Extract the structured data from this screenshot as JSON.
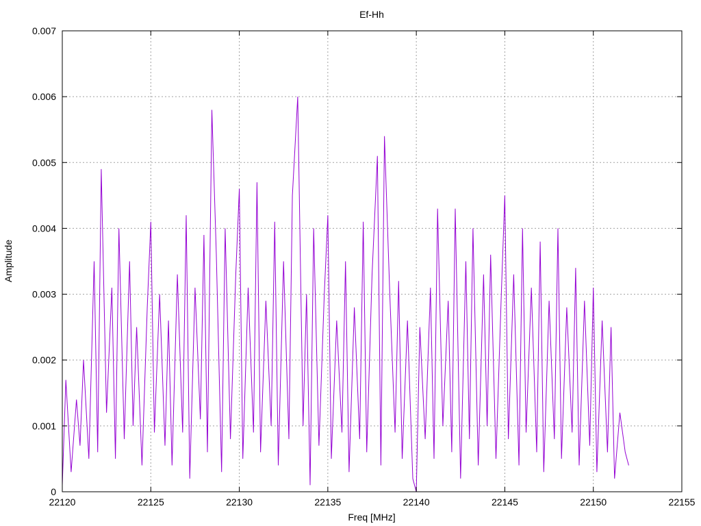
{
  "chart_data": {
    "type": "line",
    "title": "Ef-Hh",
    "xlabel": "Freq [MHz]",
    "ylabel": "Amplitude",
    "xlim": [
      22120,
      22155
    ],
    "ylim": [
      0,
      0.007
    ],
    "xticks": [
      22120,
      22125,
      22130,
      22135,
      22140,
      22145,
      22150,
      22155
    ],
    "yticks": [
      0,
      0.001,
      0.002,
      0.003,
      0.004,
      0.005,
      0.006,
      0.007
    ],
    "xtick_labels": [
      "22120",
      "22125",
      "22130",
      "22135",
      "22140",
      "22145",
      "22150",
      "22155"
    ],
    "ytick_labels": [
      "0",
      "0.001",
      "0.002",
      "0.003",
      "0.004",
      "0.005",
      "0.006",
      "0.007"
    ],
    "grid": true,
    "series_color": "#9400d3",
    "series": [
      {
        "x": [
          22120.0,
          22120.2,
          22120.5,
          22120.8,
          22121.0,
          22121.2,
          22121.5,
          22121.8,
          22122.0,
          22122.2,
          22122.5,
          22122.8,
          22123.0,
          22123.2,
          22123.5,
          22123.8,
          22124.0,
          22124.2,
          22124.5,
          22124.8,
          22125.0,
          22125.2,
          22125.5,
          22125.8,
          22126.0,
          22126.2,
          22126.5,
          22126.8,
          22127.0,
          22127.2,
          22127.5,
          22127.8,
          22128.0,
          22128.2,
          22128.45,
          22128.7,
          22129.0,
          22129.2,
          22129.5,
          22129.8,
          22130.0,
          22130.2,
          22130.5,
          22130.8,
          22131.0,
          22131.2,
          22131.5,
          22131.8,
          22132.0,
          22132.2,
          22132.5,
          22132.8,
          22133.0,
          22133.3,
          22133.6,
          22133.8,
          22134.0,
          22134.2,
          22134.5,
          22134.8,
          22135.0,
          22135.2,
          22135.5,
          22135.8,
          22136.0,
          22136.2,
          22136.5,
          22136.8,
          22137.0,
          22137.2,
          22137.5,
          22137.8,
          22138.0,
          22138.2,
          22138.5,
          22138.8,
          22139.0,
          22139.2,
          22139.5,
          22139.8,
          22140.0,
          22140.2,
          22140.5,
          22140.8,
          22141.0,
          22141.2,
          22141.5,
          22141.8,
          22142.0,
          22142.2,
          22142.5,
          22142.8,
          22143.0,
          22143.2,
          22143.5,
          22143.8,
          22144.0,
          22144.2,
          22144.5,
          22144.8,
          22145.0,
          22145.2,
          22145.5,
          22145.8,
          22146.0,
          22146.2,
          22146.5,
          22146.8,
          22147.0,
          22147.2,
          22147.5,
          22147.8,
          22148.0,
          22148.2,
          22148.5,
          22148.8,
          22149.0,
          22149.2,
          22149.5,
          22149.8,
          22150.0,
          22150.2,
          22150.5,
          22150.8,
          22151.0,
          22151.2,
          22151.5,
          22151.8,
          22152.0
        ],
        "y": [
          0.0001,
          0.0017,
          0.0003,
          0.0014,
          0.0007,
          0.002,
          0.0005,
          0.0035,
          0.0006,
          0.0049,
          0.0012,
          0.0031,
          0.0005,
          0.004,
          0.0008,
          0.0035,
          0.001,
          0.0025,
          0.0004,
          0.0028,
          0.0041,
          0.0009,
          0.003,
          0.0007,
          0.0026,
          0.0004,
          0.0033,
          0.0009,
          0.0042,
          0.0002,
          0.0031,
          0.0011,
          0.0039,
          0.0006,
          0.0058,
          0.0036,
          0.0003,
          0.004,
          0.0008,
          0.0033,
          0.0046,
          0.0005,
          0.0031,
          0.0009,
          0.0047,
          0.0006,
          0.0029,
          0.001,
          0.0041,
          0.0004,
          0.0035,
          0.0008,
          0.0045,
          0.006,
          0.001,
          0.003,
          0.0001,
          0.004,
          0.0007,
          0.003,
          0.0042,
          0.0005,
          0.0026,
          0.0009,
          0.0035,
          0.0003,
          0.0028,
          0.0008,
          0.0041,
          0.0006,
          0.0033,
          0.0051,
          0.0004,
          0.0054,
          0.003,
          0.0009,
          0.0032,
          0.0005,
          0.0026,
          0.0002,
          0.0,
          0.0025,
          0.0008,
          0.0031,
          0.0005,
          0.0043,
          0.001,
          0.0029,
          0.0006,
          0.0043,
          0.0002,
          0.0035,
          0.0008,
          0.004,
          0.0004,
          0.0033,
          0.001,
          0.0036,
          0.0005,
          0.003,
          0.0045,
          0.0008,
          0.0033,
          0.0004,
          0.004,
          0.0009,
          0.0031,
          0.0006,
          0.0038,
          0.0003,
          0.0029,
          0.0008,
          0.004,
          0.0005,
          0.0028,
          0.0009,
          0.0034,
          0.0004,
          0.0029,
          0.0007,
          0.0031,
          0.0003,
          0.0026,
          0.0006,
          0.0025,
          0.0002,
          0.0012,
          0.0006,
          0.0004
        ]
      }
    ]
  }
}
